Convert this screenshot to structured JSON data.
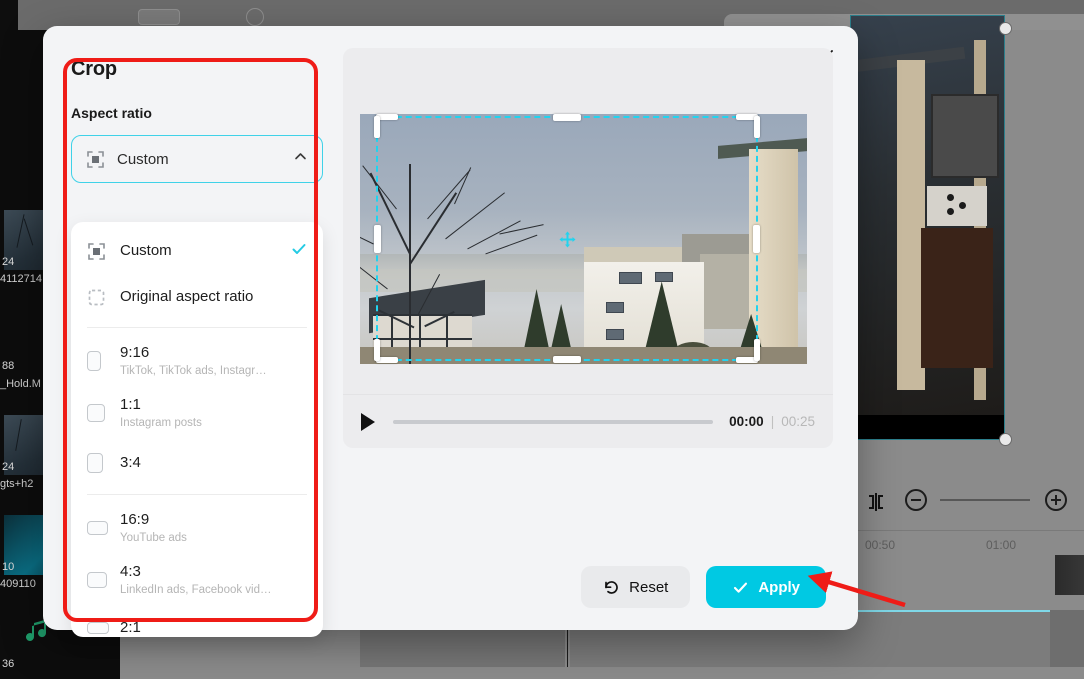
{
  "modal": {
    "title": "Crop",
    "close_icon": "close-icon",
    "aspect_ratio_label": "Aspect ratio",
    "selected_ratio": "Custom",
    "chevron_icon": "chevron-up-icon",
    "options": [
      {
        "label": "Custom",
        "sub": "",
        "icon": "crop-frame-icon",
        "selected": true,
        "cb_w": 0,
        "cb_h": 0
      },
      {
        "label": "Original aspect ratio",
        "sub": "",
        "icon": "dashed-square-icon",
        "selected": false,
        "cb_w": 0,
        "cb_h": 0
      },
      {
        "label": "9:16",
        "sub": "TikTok, TikTok ads, Instagr…",
        "icon": "ratio-checkbox-icon",
        "selected": false,
        "cb_w": 14,
        "cb_h": 20
      },
      {
        "label": "1:1",
        "sub": "Instagram posts",
        "icon": "ratio-checkbox-icon",
        "selected": false,
        "cb_w": 18,
        "cb_h": 18
      },
      {
        "label": "3:4",
        "sub": "",
        "icon": "ratio-checkbox-icon",
        "selected": false,
        "cb_w": 16,
        "cb_h": 20
      },
      {
        "label": "16:9",
        "sub": "YouTube ads",
        "icon": "ratio-checkbox-icon",
        "selected": false,
        "cb_w": 21,
        "cb_h": 14
      },
      {
        "label": "4:3",
        "sub": "LinkedIn ads, Facebook vid…",
        "icon": "ratio-checkbox-icon",
        "selected": false,
        "cb_w": 20,
        "cb_h": 16
      },
      {
        "label": "2:1",
        "sub": "",
        "icon": "ratio-checkbox-icon",
        "selected": false,
        "cb_w": 22,
        "cb_h": 12
      }
    ],
    "player": {
      "play_icon": "play-icon",
      "current_time": "00:00",
      "separator": "|",
      "total_time": "00:25"
    },
    "footer": {
      "reset_label": "Reset",
      "reset_icon": "undo-icon",
      "apply_label": "Apply",
      "apply_icon": "check-icon"
    },
    "colors": {
      "accent": "#00c9e3",
      "crop_outline": "#22d3ee",
      "annotation": "#ef1c17"
    }
  },
  "background": {
    "media_items": [
      {
        "duration": "24",
        "name": "4112714"
      },
      {
        "duration": "88",
        "name": "_Hold.M"
      },
      {
        "duration": "24",
        "name": "gts+h2"
      },
      {
        "duration": "10",
        "name": "409110"
      },
      {
        "duration": "36",
        "name": ""
      }
    ],
    "timeline": {
      "split_icon": "split-icon",
      "zoom_out_icon": "zoom-out-icon",
      "zoom_in_icon": "zoom-in-icon",
      "ticks": [
        "00:50",
        "01:00"
      ]
    }
  }
}
